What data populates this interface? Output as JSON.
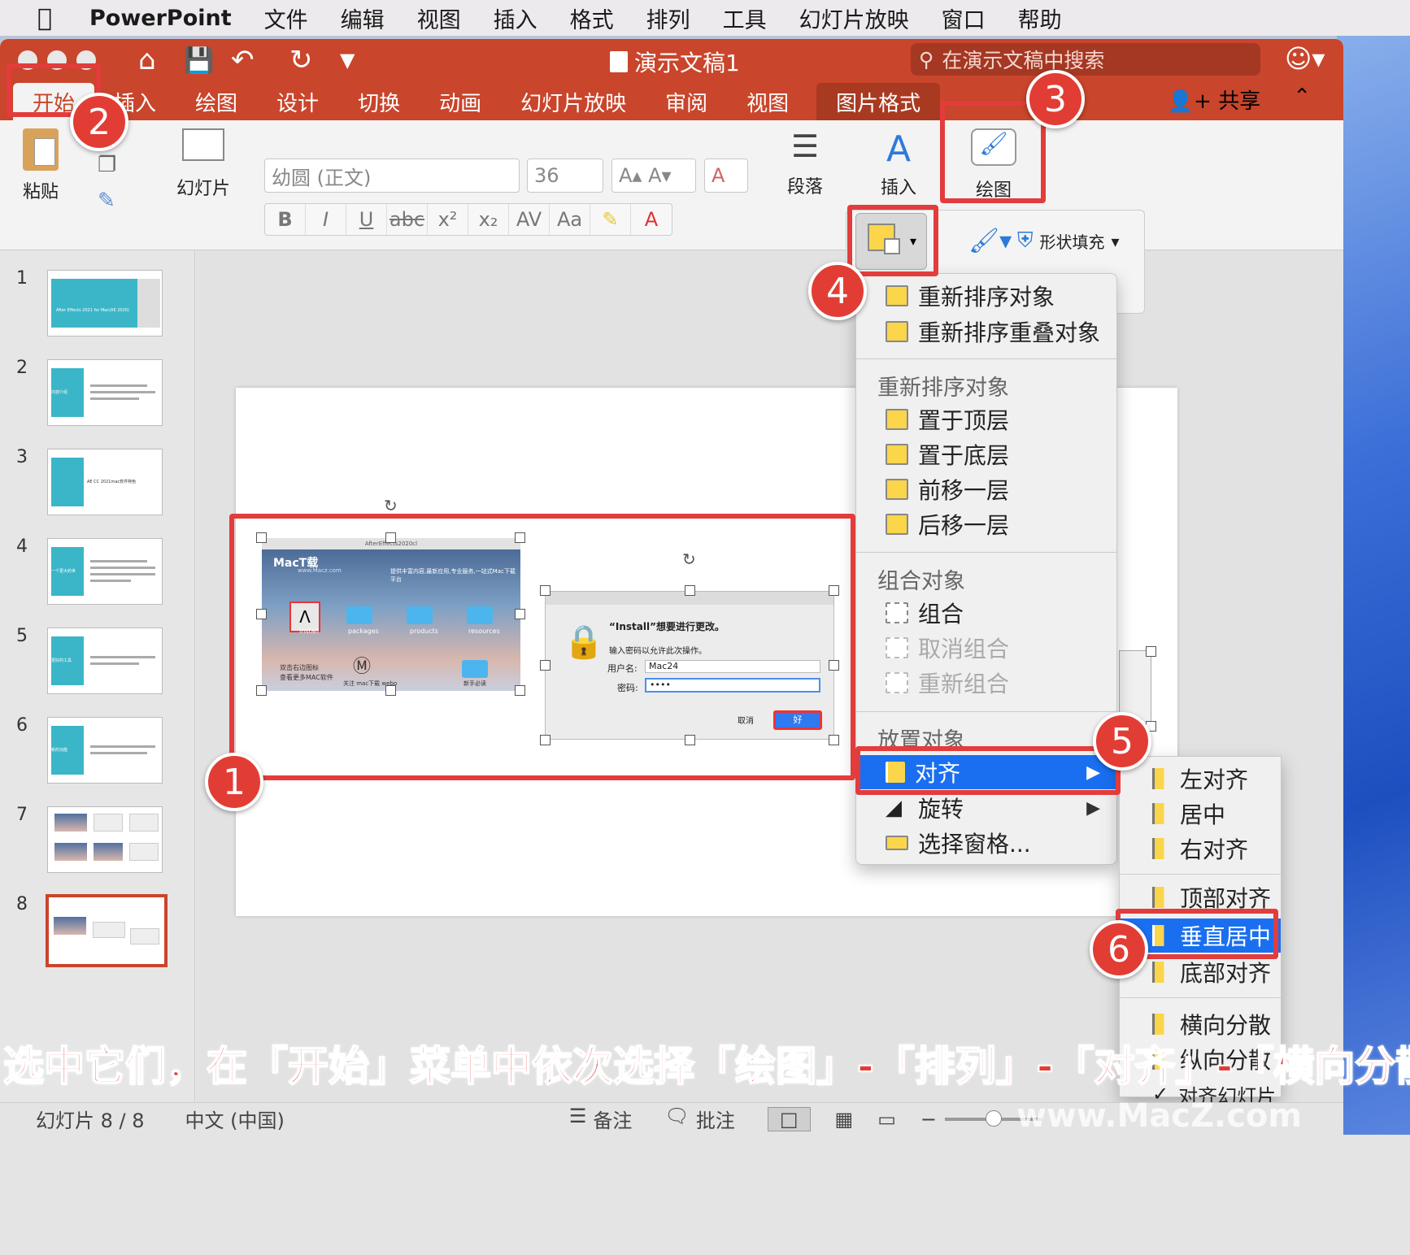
{
  "menubar": {
    "app": "PowerPoint",
    "items": [
      "文件",
      "编辑",
      "视图",
      "插入",
      "格式",
      "排列",
      "工具",
      "幻灯片放映",
      "窗口",
      "帮助"
    ]
  },
  "titlebar": {
    "doc_title": "演示文稿1",
    "search_placeholder": "在演示文稿中搜索"
  },
  "tabs": [
    "开始",
    "插入",
    "绘图",
    "设计",
    "切换",
    "动画",
    "幻灯片放映",
    "审阅",
    "视图",
    "图片格式"
  ],
  "share_label": "共享",
  "ribbon": {
    "paste": "粘贴",
    "slide": "幻灯片",
    "font_name": "幼圆 (正文)",
    "font_size": "36",
    "paragraph": "段落",
    "insert": "插入",
    "draw": "绘图",
    "shape_fill": "形状填充"
  },
  "slides": [
    "1",
    "2",
    "3",
    "4",
    "5",
    "6",
    "7",
    "8"
  ],
  "thumb_texts": {
    "t1": "After Effects 2021 for Mac(AE 2020)",
    "t2": "内容介绍",
    "t3": "AE CC 2021mac软件特色",
    "t4": "一个更大的世",
    "t5": "更好的工具",
    "t6": "新的功能"
  },
  "image1": {
    "window_title": "AfterEffects2020cl",
    "brand": "MacT载",
    "brand_url": "www.Macz.com",
    "tagline": "提供丰富内容,最新应用,专业服务,一站式Mac下载平台",
    "folders": [
      "install",
      "packages",
      "products",
      "resources"
    ],
    "hint1": "双击右边图标",
    "hint2": "查看更多MAC软件",
    "hint3": "关注 mac下载 webo",
    "hint4": "新手必读"
  },
  "image2": {
    "title": "“Install”想要进行更改。",
    "subtitle": "输入密码以允许此次操作。",
    "user_label": "用户名:",
    "user_value": "Mac24",
    "pass_label": "密码:",
    "pass_value": "••••",
    "cancel": "取消",
    "ok": "好"
  },
  "arrange_menu": {
    "top1": "重新排序对象",
    "top2": "重新排序重叠对象",
    "head_reorder": "重新排序对象",
    "bring_front": "置于顶层",
    "send_back": "置于底层",
    "forward": "前移一层",
    "backward": "后移一层",
    "head_group": "组合对象",
    "group": "组合",
    "ungroup": "取消组合",
    "regroup": "重新组合",
    "head_place": "放置对象",
    "align": "对齐",
    "rotate": "旋转",
    "pane": "选择窗格..."
  },
  "align_menu": {
    "left": "左对齐",
    "center": "居中",
    "right": "右对齐",
    "top": "顶部对齐",
    "middle": "垂直居中",
    "bottom": "底部对齐",
    "distribute_h": "横向分散",
    "distribute_v": "纵向分散",
    "slide_align": "对齐幻灯片"
  },
  "badges": [
    "1",
    "2",
    "3",
    "4",
    "5",
    "6"
  ],
  "caption": "选中它们，在「开始」菜单中依次选择「绘图」-「排列」-「对齐」-「横向分散」",
  "status": {
    "slide_info": "幻灯片 8 / 8",
    "language": "中文 (中国)",
    "notes": "备注",
    "comments": "批注"
  },
  "watermark": "www.MacZ.com",
  "colors": {
    "accent": "#c9452b",
    "highlight": "#e23d35",
    "selection": "#1a6ff0"
  }
}
